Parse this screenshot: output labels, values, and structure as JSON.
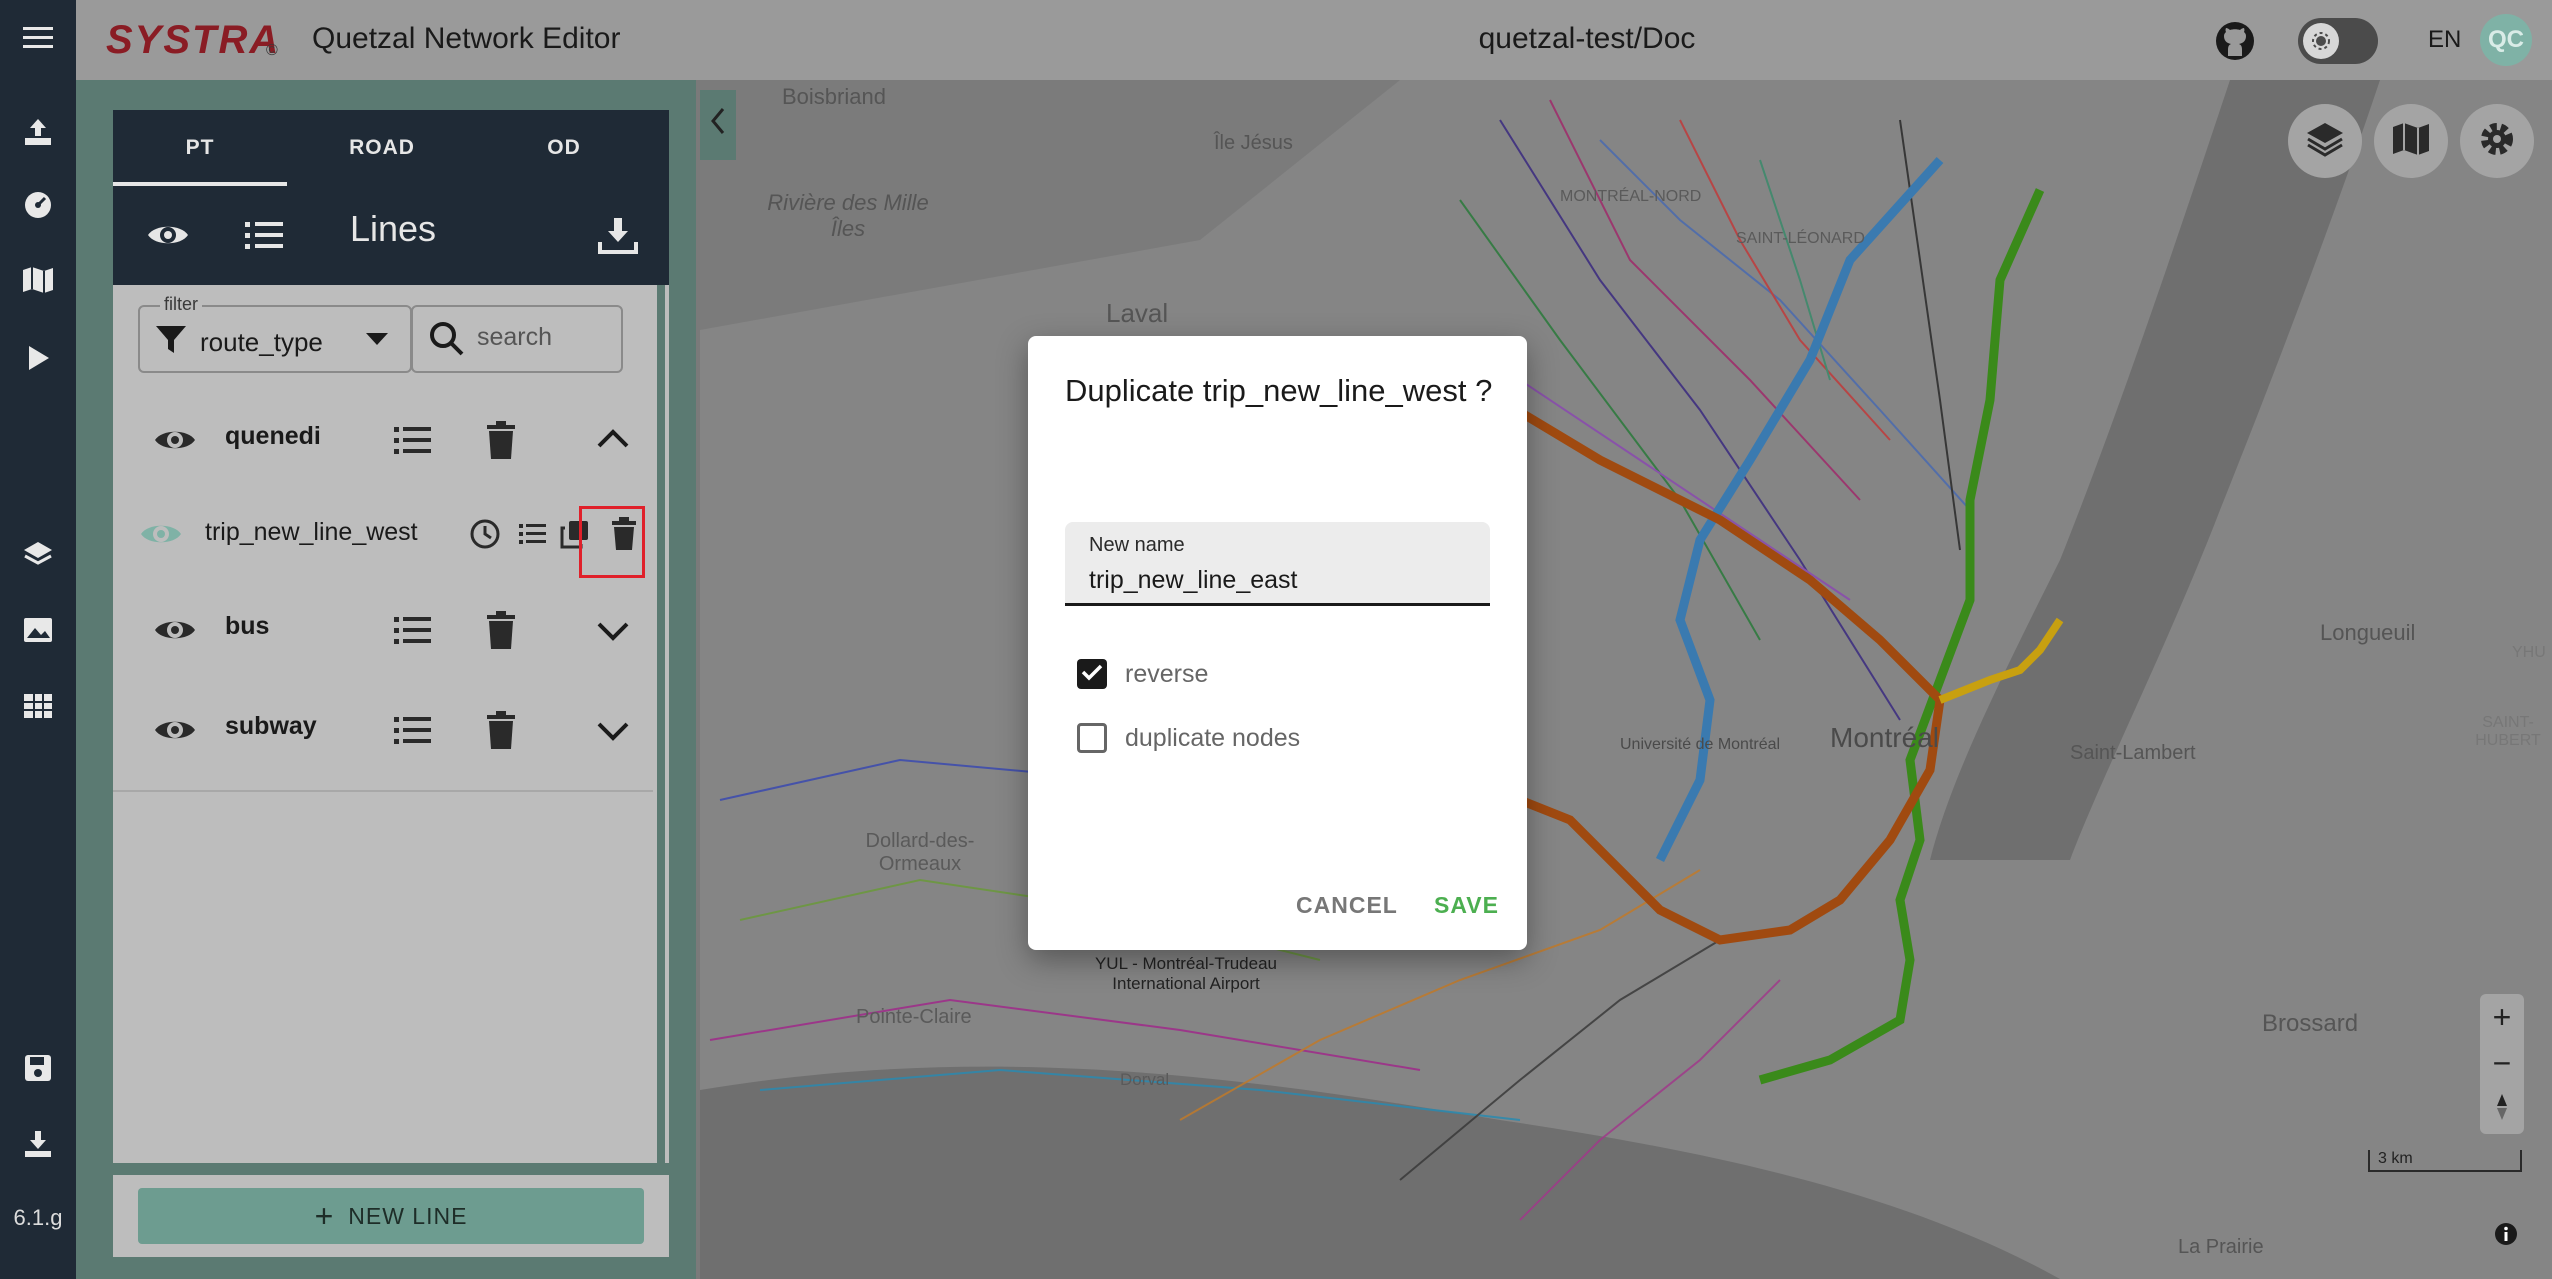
{
  "app": {
    "brand": "SYSTRA",
    "brand_mark": "©",
    "title": "Quetzal Network Editor",
    "project": "quetzal-test/Doc",
    "language": "EN",
    "avatar_initials": "QC",
    "version": "6.1.g"
  },
  "panel": {
    "tabs": [
      {
        "label": "PT",
        "active": true
      },
      {
        "label": "ROAD",
        "active": false
      },
      {
        "label": "OD",
        "active": false
      }
    ],
    "title": "Lines",
    "filter": {
      "label": "filter",
      "value": "route_type"
    },
    "search": {
      "placeholder": "search"
    },
    "groups": [
      {
        "name": "quenedi",
        "expanded": true
      },
      {
        "name": "bus",
        "expanded": false
      },
      {
        "name": "subway",
        "expanded": false
      }
    ],
    "trip": {
      "name": "trip_new_line_west"
    },
    "new_line_label": "NEW LINE"
  },
  "map": {
    "labels": [
      "Boisbriand",
      "Île Jésus",
      "Rivière des Mille Îles",
      "Laval",
      "Longueuil",
      "Saint-Lambert",
      "SAINT-HUBERT",
      "YHU",
      "Dollard-des-Ormeaux",
      "Pointe-Claire",
      "YUL - Montréal-Trudeau International Airport",
      "Dorval",
      "Brossard",
      "La Prairie",
      "Montréal",
      "Université de Montréal",
      "MONTRÉAL-NORD",
      "SAINT-LÉONARD"
    ],
    "scale_label": "3 km",
    "zoom_in": "+",
    "zoom_out": "−"
  },
  "dialog": {
    "title": "Duplicate trip_new_line_west ?",
    "field_label": "New name",
    "field_value": "trip_new_line_east",
    "reverse_label": "reverse",
    "reverse_checked": true,
    "duplicate_nodes_label": "duplicate nodes",
    "duplicate_nodes_checked": false,
    "cancel_label": "CANCEL",
    "save_label": "SAVE"
  },
  "colors": {
    "rail_bg": "#1f2a36",
    "panel_teal": "#5b7a72",
    "brand_red": "#8a1c24",
    "save_green": "#4caf50",
    "highlight_red": "#e0202a"
  }
}
